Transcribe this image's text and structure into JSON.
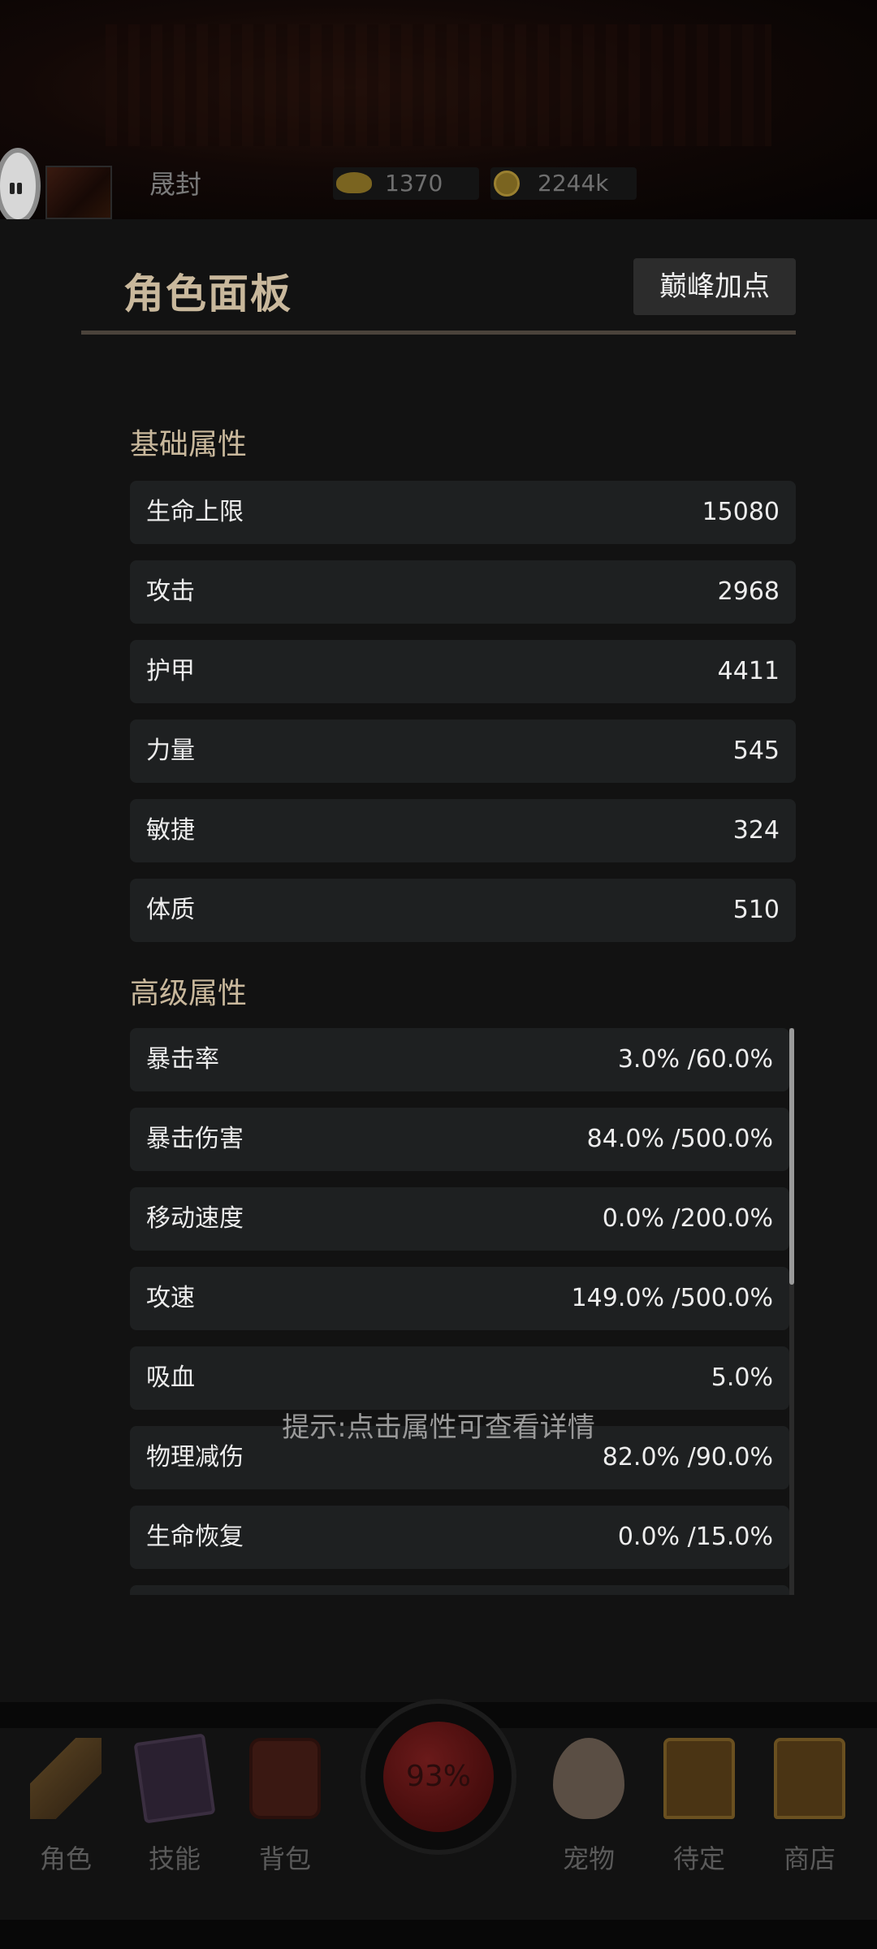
{
  "hud": {
    "player_name": "晟封",
    "gold": "1370",
    "coins": "2244k",
    "menu_icon": "pause-icon",
    "gold_icon": "gold-ingot-icon",
    "coin_icon": "coin-icon"
  },
  "panel": {
    "title": "角色面板",
    "peak_button": "巅峰加点",
    "basic_title": "基础属性",
    "basic": [
      {
        "label": "生命上限",
        "value": "15080"
      },
      {
        "label": "攻击",
        "value": "2968"
      },
      {
        "label": "护甲",
        "value": "4411"
      },
      {
        "label": "力量",
        "value": "545"
      },
      {
        "label": "敏捷",
        "value": "324"
      },
      {
        "label": "体质",
        "value": "510"
      }
    ],
    "advanced_title": "高级属性",
    "advanced": [
      {
        "label": "暴击率",
        "value": "3.0% /60.0%"
      },
      {
        "label": "暴击伤害",
        "value": "84.0% /500.0%"
      },
      {
        "label": "移动速度",
        "value": "0.0% /200.0%"
      },
      {
        "label": "攻速",
        "value": "149.0% /500.0%"
      },
      {
        "label": "吸血",
        "value": "5.0%"
      },
      {
        "label": "物理减伤",
        "value": "82.0% /90.0%"
      },
      {
        "label": "生命恢复",
        "value": "0.0% /15.0%"
      }
    ],
    "hint": "提示:点击属性可查看详情"
  },
  "nav": {
    "orb_value": "93%",
    "items": [
      {
        "label": "角色",
        "icon": "tent-icon"
      },
      {
        "label": "技能",
        "icon": "spellbook-icon"
      },
      {
        "label": "背包",
        "icon": "backpack-icon"
      },
      {
        "label": "宠物",
        "icon": "egg-icon"
      },
      {
        "label": "待定",
        "icon": "chest-icon"
      },
      {
        "label": "商店",
        "icon": "chest-icon"
      }
    ]
  },
  "colors": {
    "panel_bg": "#121212",
    "row_bg": "#1e2021",
    "title_gold": "#c9b89c",
    "button_bg": "#2c2c2c"
  }
}
